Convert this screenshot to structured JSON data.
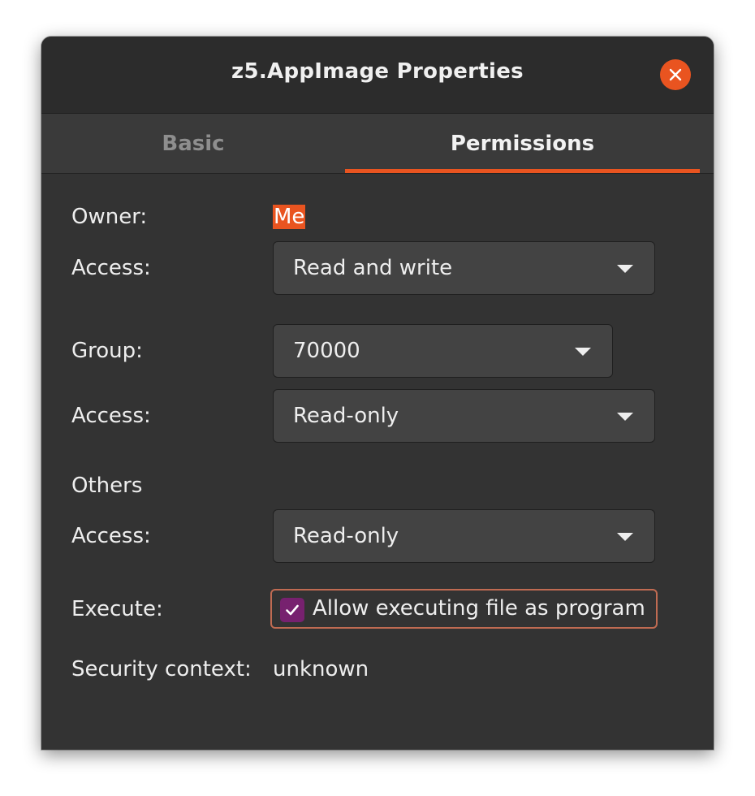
{
  "window": {
    "title": "z5.AppImage Properties",
    "close_icon": "close-icon"
  },
  "tabs": [
    {
      "label": "Basic",
      "active": false
    },
    {
      "label": "Permissions",
      "active": true
    }
  ],
  "owner": {
    "label": "Owner:",
    "value": "Me",
    "access_label": "Access:",
    "access_value": "Read and write"
  },
  "group": {
    "label": "Group:",
    "value": "70000",
    "access_label": "Access:",
    "access_value": "Read-only"
  },
  "others": {
    "label": "Others",
    "access_label": "Access:",
    "access_value": "Read-only"
  },
  "execute": {
    "label": "Execute:",
    "checkbox_label": "Allow executing file as program",
    "checked": true
  },
  "security": {
    "label": "Security context:",
    "value": "unknown"
  },
  "colors": {
    "accent": "#e95420",
    "checkbox": "#77216f",
    "background": "#333333"
  }
}
